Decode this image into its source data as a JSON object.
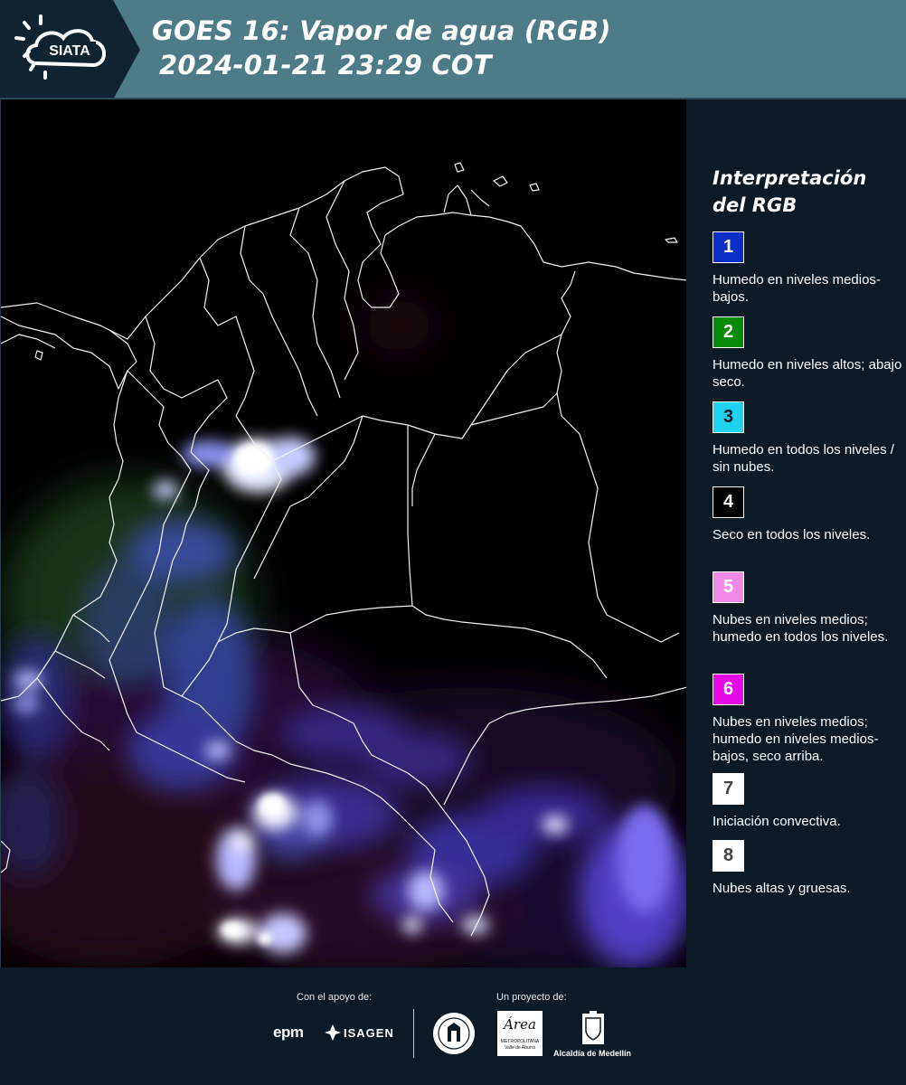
{
  "header": {
    "logo_text": "SIATA",
    "title_line1": "GOES 16: Vapor de agua (RGB)",
    "title_line2": "2024-01-21 23:29 COT"
  },
  "legend": {
    "title": "Interpretación del RGB",
    "items": [
      {
        "number": "1",
        "color": "#0a2fc8",
        "number_color": "#ffffff",
        "text": "Humedo en niveles medios-bajos."
      },
      {
        "number": "2",
        "color": "#0a8a0a",
        "number_color": "#ffffff",
        "text": "Humedo en niveles altos; abajo seco."
      },
      {
        "number": "3",
        "color": "#1fd2f0",
        "number_color": "#0c1a26",
        "text": "Humedo en todos los niveles / sin nubes."
      },
      {
        "number": "4",
        "color": "#000000",
        "number_color": "#ffffff",
        "text": "Seco en todos los niveles."
      },
      {
        "number": "5",
        "color": "#f08ae6",
        "number_color": "#ffffff",
        "text": "Nubes en niveles medios; humedo en todos los niveles."
      },
      {
        "number": "6",
        "color": "#e60ae6",
        "number_color": "#ffffff",
        "text": "Nubes en niveles medios; humedo en niveles medios-bajos, seco arriba."
      },
      {
        "number": "7",
        "color": "#ffffff",
        "number_color": "#444444",
        "text": "Iniciación convectiva."
      },
      {
        "number": "8",
        "color": "#ffffff",
        "number_color": "#444444",
        "text": "Nubes altas y gruesas."
      }
    ]
  },
  "footer": {
    "support_label": "Con el apoyo de:",
    "project_label": "Un proyecto de:",
    "epm_text": "epm",
    "isagen_text": "ISAGEN",
    "area_text": "Área",
    "area_subtext": "METROPOLITANA",
    "area_subtext2": "Valle de Aburrá",
    "alcaldia_text": "Alcaldía de Medellín"
  }
}
